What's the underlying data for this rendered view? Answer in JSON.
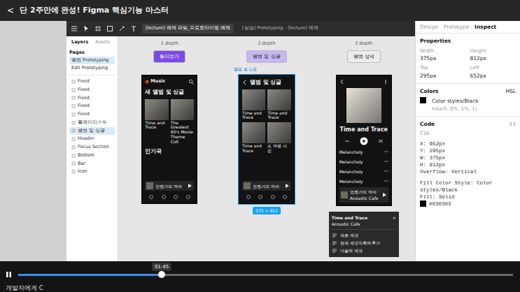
{
  "video": {
    "back": "<",
    "title": "단 2주만에 완성! Figma 핵심기능 마스터",
    "time": "01:45",
    "level": 0.29,
    "playing": true,
    "caption": "개발자에게 C"
  },
  "figma": {
    "tabs": [
      {
        "label": "[lecture] 예제 파일_프로토타이핑 예제",
        "selected": true
      },
      {
        "label": "[실습] Prototyping - [lecture] 예제",
        "selected": false
      }
    ]
  },
  "layers": {
    "tabs": [
      {
        "label": "Layers",
        "selected": true
      },
      {
        "label": "Assets",
        "selected": false
      }
    ],
    "pages_label": "Pages",
    "pages": [
      {
        "label": "앨범 Prototyping",
        "selected": true
      },
      {
        "label": "Edit Prototyping",
        "selected": false
      }
    ],
    "items": [
      {
        "label": "Fixed",
        "selected": false
      },
      {
        "label": "Fixed",
        "selected": false
      },
      {
        "label": "Fixed",
        "selected": false
      },
      {
        "label": "Fixed",
        "selected": false
      },
      {
        "label": "Fixed",
        "selected": false
      },
      {
        "label": "플레이리스트",
        "selected": false
      },
      {
        "label": "앨범 및 싱글",
        "selected": true
      },
      {
        "label": "Header",
        "selected": false
      },
      {
        "label": "Focus Section",
        "selected": false
      },
      {
        "label": "Bottom",
        "selected": false
      },
      {
        "label": "Bar",
        "selected": false
      },
      {
        "label": "Icon",
        "selected": false
      }
    ]
  },
  "canvas": {
    "columns": [
      {
        "depth": "1 depth",
        "button": "둘러보기",
        "color": "#7b4ae2"
      },
      {
        "depth": "2 depth",
        "button": "앨범 및 싱글",
        "color": "#c7b6f2"
      },
      {
        "depth": "3 depth",
        "button": "앨범 상세",
        "color": "#ececec"
      }
    ],
    "frames": [
      {
        "kind": "home",
        "logo": "Music",
        "heading": "새 앨범 및 싱글",
        "items": [
          "Time and Trace",
          "The Greatest 90's Movie Theme Coll"
        ],
        "section": "인기곡",
        "player": "언젠가의 여자",
        "selected": false
      },
      {
        "kind": "grid",
        "label": "앨범 및 싱글",
        "heading": "앨범 및 싱글",
        "items": [
          "Time and Trace",
          "Time and Trace",
          "Time and Trace",
          "조 여행 사진"
        ],
        "player": "언젠가의 여자",
        "selected": true
      },
      {
        "kind": "detail",
        "heading": "Time and Trace",
        "items": [
          "Melancholy",
          "Melancholy",
          "Melancholy",
          "Melancholy"
        ],
        "player": "언젠가의 여자",
        "artist": "Acoustic Cafe",
        "selected": false
      }
    ],
    "size_badge": "375 × 812",
    "sheet": {
      "title": "Time and Trace",
      "subtitle": "Acoustic Cafe",
      "close": "×",
      "items": [
        "새로 재생",
        "현재 재생목록에 추가",
        "다음에 재생"
      ]
    }
  },
  "inspector": {
    "tabs": [
      {
        "label": "Design",
        "selected": false
      },
      {
        "label": "Prototype",
        "selected": false
      },
      {
        "label": "Inspect",
        "selected": true
      }
    ],
    "properties_title": "Properties",
    "properties": [
      {
        "label": "Width",
        "value": "375px"
      },
      {
        "label": "Height",
        "value": "812px"
      },
      {
        "label": "Top",
        "value": "295px"
      },
      {
        "label": "Left",
        "value": "652px"
      }
    ],
    "colors": {
      "title": "Colors",
      "mode": "HSL",
      "swatch": "#030303",
      "name": "Color styles/Black",
      "value": "hsla(0, 0%, 1%, 1)"
    },
    "code": {
      "title": "Code",
      "lang": "CSS",
      "lines": [
        "X: 652px",
        "Y: 295px",
        "W: 375px",
        "H: 812px",
        "Overflow: Vertical"
      ],
      "fill_lines": [
        "Fill Color Style: Color",
        "styles/Black",
        "Fill: Solid"
      ],
      "hex": "#030303"
    }
  }
}
